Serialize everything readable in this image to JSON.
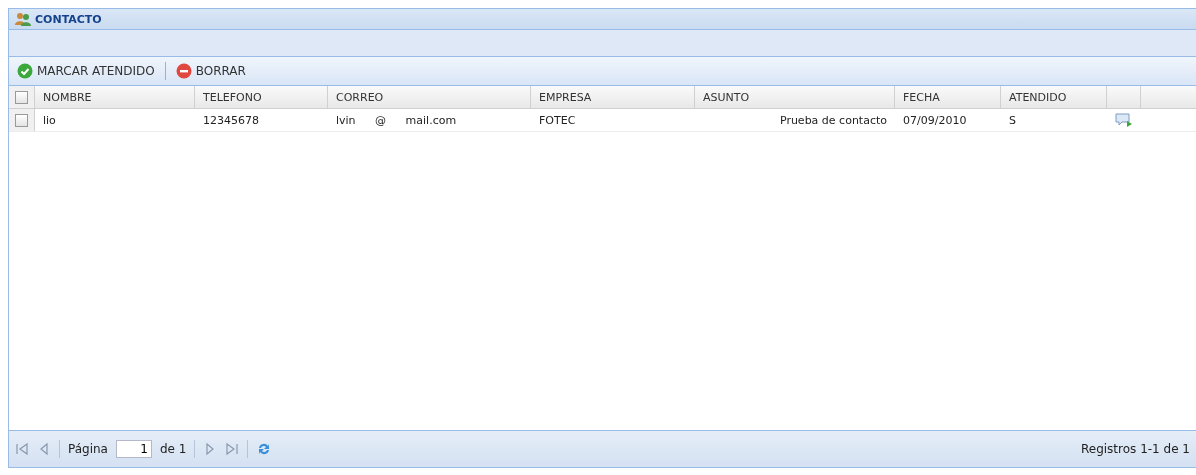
{
  "panel": {
    "title": "CONTACTO"
  },
  "toolbar": [
    {
      "label": "MARCAR ATENDIDO",
      "kind": "check"
    },
    {
      "label": "BORRAR",
      "kind": "delete"
    }
  ],
  "table": {
    "select_all": {
      "checked": false
    },
    "columns": [
      "NOMBRE",
      "TELEFONO",
      "CORREO",
      "EMPRESA",
      "ASUNTO",
      "FECHA",
      "ATENDIDO"
    ],
    "rows": [
      {
        "checked": false,
        "cells": [
          "lio",
          "12345678",
          "lvin @ mail.com",
          "FOTEC",
          "Prueba de contacto",
          "07/09/2010",
          "S"
        ]
      }
    ]
  },
  "pager": {
    "page_label": "Página",
    "page": "1",
    "of": "de 1",
    "summary": "Registros 1-1 de 1"
  }
}
